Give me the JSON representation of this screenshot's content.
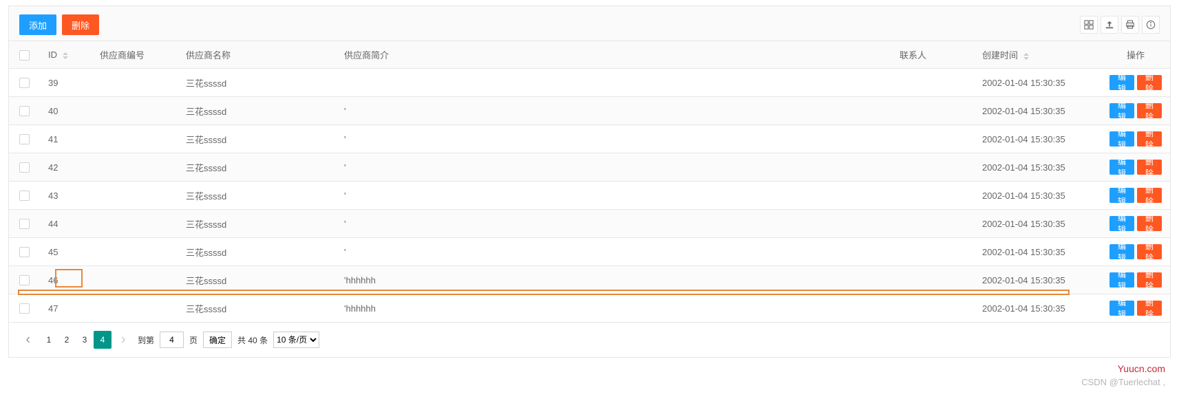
{
  "toolbar": {
    "add_label": "添加",
    "delete_label": "删除"
  },
  "columns": {
    "id": "ID",
    "supplier_no": "供应商编号",
    "supplier_name": "供应商名称",
    "desc": "供应商简介",
    "contact": "联系人",
    "created": "创建时间",
    "op": "操作"
  },
  "rows": [
    {
      "id": "39",
      "supplier_no": "",
      "supplier_name": "三花ssssd",
      "desc": "",
      "contact": "",
      "created": "2002-01-04 15:30:35"
    },
    {
      "id": "40",
      "supplier_no": "",
      "supplier_name": "三花ssssd",
      "desc": "'",
      "contact": "",
      "created": "2002-01-04 15:30:35"
    },
    {
      "id": "41",
      "supplier_no": "",
      "supplier_name": "三花ssssd",
      "desc": "'",
      "contact": "",
      "created": "2002-01-04 15:30:35"
    },
    {
      "id": "42",
      "supplier_no": "",
      "supplier_name": "三花ssssd",
      "desc": "'",
      "contact": "",
      "created": "2002-01-04 15:30:35"
    },
    {
      "id": "43",
      "supplier_no": "",
      "supplier_name": "三花ssssd",
      "desc": "'",
      "contact": "",
      "created": "2002-01-04 15:30:35"
    },
    {
      "id": "44",
      "supplier_no": "",
      "supplier_name": "三花ssssd",
      "desc": "'",
      "contact": "",
      "created": "2002-01-04 15:30:35"
    },
    {
      "id": "45",
      "supplier_no": "",
      "supplier_name": "三花ssssd",
      "desc": "'",
      "contact": "",
      "created": "2002-01-04 15:30:35"
    },
    {
      "id": "46",
      "supplier_no": "",
      "supplier_name": "三花ssssd",
      "desc": "'hhhhhh",
      "contact": "",
      "created": "2002-01-04 15:30:35"
    },
    {
      "id": "47",
      "supplier_no": "",
      "supplier_name": "三花ssssd",
      "desc": "'hhhhhh",
      "contact": "",
      "created": "2002-01-04 15:30:35"
    }
  ],
  "row_actions": {
    "edit": "编辑",
    "delete": "删除"
  },
  "pager": {
    "pages": [
      "1",
      "2",
      "3",
      "4"
    ],
    "active": "4",
    "goto_prefix": "到第",
    "goto_value": "4",
    "goto_suffix": "页",
    "confirm": "确定",
    "total": "共 40 条",
    "per_page_selected": "10 条/页"
  },
  "footer": {
    "brand": "Yuucn.com",
    "watermark": "CSDN @Tuerlechat ,"
  }
}
